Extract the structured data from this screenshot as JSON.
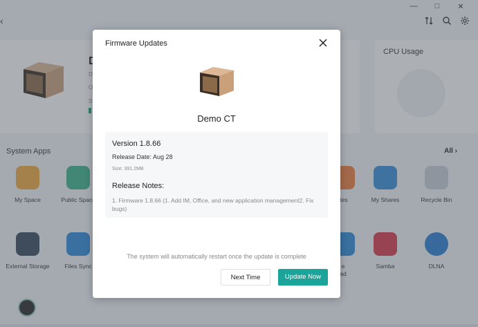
{
  "background": {
    "device": {
      "name_visible": "D",
      "line1": "D",
      "line2": "O",
      "line3": "S"
    },
    "cpu_card": {
      "title": "CPU Usage"
    },
    "apps": {
      "title": "System Apps",
      "all_label": "All",
      "row1": [
        {
          "label": "My Space",
          "icon": "my-space-icon",
          "color": "#f0a93c"
        },
        {
          "label": "Public Space",
          "icon": "public-space-icon",
          "color": "#3fb38a"
        },
        {
          "label": "ites",
          "icon": "favorites-icon",
          "color": "#f07e3c"
        },
        {
          "label": "My Shares",
          "icon": "my-shares-icon",
          "color": "#3b8fd8"
        },
        {
          "label": "Recycle Bin",
          "icon": "recycle-bin-icon",
          "color": "#c9ced6"
        }
      ],
      "row2": [
        {
          "label": "External Storage",
          "icon": "external-storage-icon",
          "color": "#3a4a5c"
        },
        {
          "label": "Files Sync",
          "icon": "files-sync-icon",
          "color": "#2e8ad8"
        },
        {
          "label": "e\nad",
          "icon": "download-icon",
          "color": "#2e8ad8"
        },
        {
          "label": "Samba",
          "icon": "samba-icon",
          "color": "#d93a4a"
        },
        {
          "label": "DLNA",
          "icon": "dlna-icon",
          "color": "#2b7fd2"
        }
      ]
    }
  },
  "modal": {
    "title": "Firmware Updates",
    "device_name": "Demo CT",
    "version": "Version 1.8.66",
    "release_date": "Release Date: Aug 28",
    "size": "Size: 391.2MB",
    "notes_heading": "Release Notes:",
    "notes_body": "1. Firmware 1.8.66 (1. Add IM, Office, and new application management2. Fix bugs)",
    "restart_notice": "The system will automatically restart once the update is complete",
    "next_time_label": "Next Time",
    "update_now_label": "Update Now"
  },
  "colors": {
    "accent": "#1aa49a",
    "overlay": "rgba(70,80,90,0.45)",
    "status_green": "#1ea672"
  }
}
